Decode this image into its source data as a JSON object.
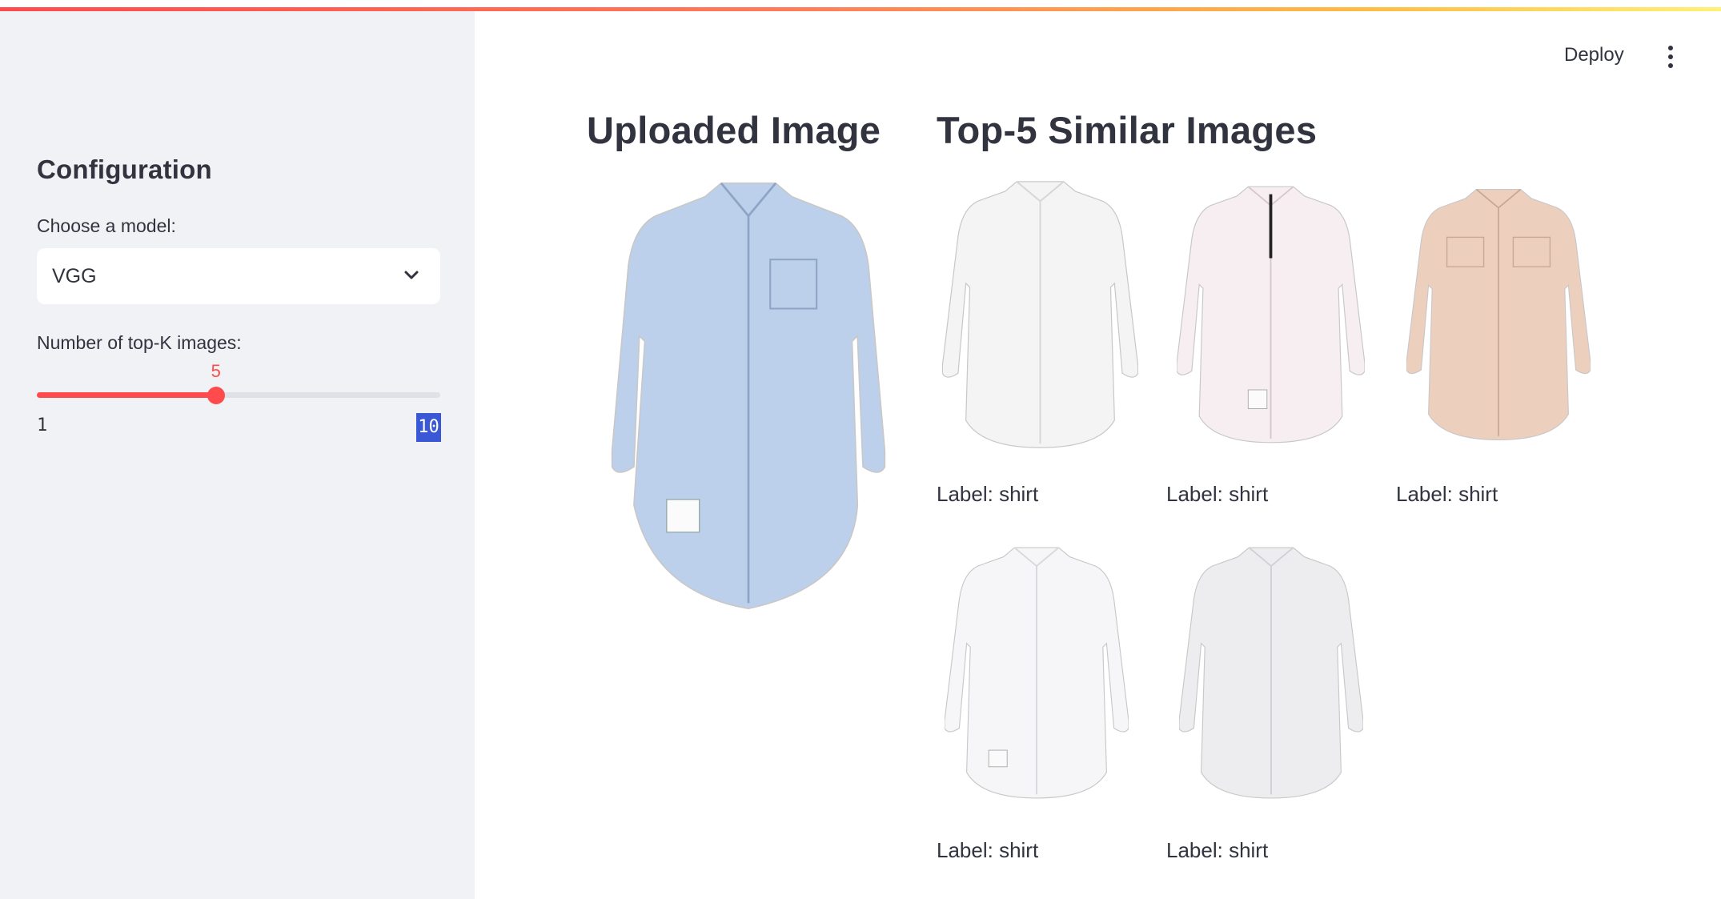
{
  "sidebar": {
    "title": "Configuration",
    "model_label": "Choose a model:",
    "model_value": "VGG",
    "topk_label": "Number of top-K images:",
    "slider": {
      "value": "5",
      "min": "1",
      "max": "10",
      "fraction": 0.444
    }
  },
  "header": {
    "deploy_label": "Deploy",
    "menu_icon": "vertical-ellipsis-icon"
  },
  "main": {
    "uploaded_title": "Uploaded Image",
    "similar_title": "Top-5 Similar Images",
    "results": [
      {
        "label": "Label: shirt",
        "color": "#f4f4f4"
      },
      {
        "label": "Label: shirt",
        "color": "#f7eef2"
      },
      {
        "label": "Label: shirt",
        "color": "#edcfbe"
      },
      {
        "label": "Label: shirt",
        "color": "#f6f6f8"
      },
      {
        "label": "Label: shirt",
        "color": "#ededf0"
      }
    ],
    "uploaded_color": "#bcd0ec"
  },
  "colors": {
    "accent": "#ff4b4b",
    "sidebar_bg": "#f0f2f6",
    "text": "#31333f",
    "max_highlight": "#3a58d5"
  }
}
